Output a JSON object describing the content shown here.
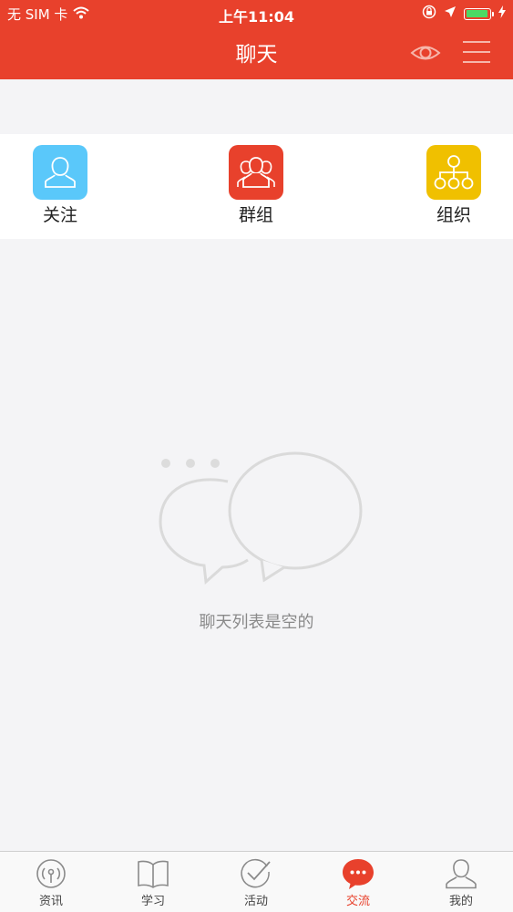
{
  "status_bar": {
    "carrier": "无 SIM 卡",
    "time": "上午11:04",
    "battery_level": 0.95
  },
  "header": {
    "title": "聊天",
    "color": "#e8412c"
  },
  "shortcuts": [
    {
      "label": "关注",
      "icon": "person-icon",
      "color": "#5ac8fa"
    },
    {
      "label": "群组",
      "icon": "group-icon",
      "color": "#e8412c"
    },
    {
      "label": "组织",
      "icon": "org-chart-icon",
      "color": "#f0c000"
    }
  ],
  "empty_state": {
    "message": "聊天列表是空的",
    "icon": "chat-bubbles-icon"
  },
  "tabbar": {
    "active_index": 3,
    "tabs": [
      {
        "label": "资讯",
        "icon": "antenna-icon"
      },
      {
        "label": "学习",
        "icon": "book-icon"
      },
      {
        "label": "活动",
        "icon": "check-circle-icon"
      },
      {
        "label": "交流",
        "icon": "chat-dots-icon"
      },
      {
        "label": "我的",
        "icon": "profile-icon"
      }
    ]
  }
}
